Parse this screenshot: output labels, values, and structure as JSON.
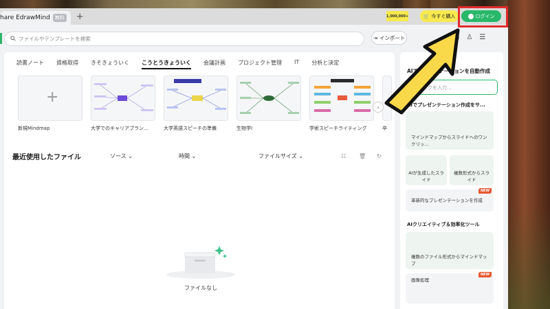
{
  "titlebar": {
    "app_title": "hare EdrawMind",
    "plan_badge": "無料",
    "new_tab_symbol": "+",
    "promo_text": "1,000,000+",
    "buy_label": "今すぐ購入",
    "login_label": "ログイン"
  },
  "toolbar": {
    "search_placeholder": "ファイルやテンプレートを検索",
    "import_label": "インポート"
  },
  "tabs": [
    "読書ノート",
    "資格取得",
    "きそきょういく",
    "こうとうきょういく",
    "会議計画",
    "プロジェクト管理",
    "IT",
    "分析と決定"
  ],
  "active_tab": "こうとうきょういく",
  "templates": [
    {
      "name": "新規Mindmap"
    },
    {
      "name": "大学でのキャリアプラン..."
    },
    {
      "name": "大学英語スピーチの準備"
    },
    {
      "name": "生物学I"
    },
    {
      "name": "学術スピーチライティング"
    },
    {
      "name": "卒"
    }
  ],
  "recent": {
    "title": "最近使用したファイル",
    "col_source": "ソース",
    "col_time": "時間",
    "col_size": "ファイルサイズ",
    "empty_label": "ファイルなし"
  },
  "sidebar": {
    "ai_title": "AIでプレゼンテーションを自動作成",
    "input_placeholder": "トピックを入力...",
    "presentation_title": "AIでプレゼンテーション作成をサ...",
    "card1": "マインドマップからスライドへのワンクリッ...",
    "card2": "AIが生成したスライド",
    "card3": "複数形式からスライド",
    "card4": "革新的なプレゼンテーションを作成",
    "tools_title": "AIクリエイティブ＆効率化ツール",
    "card5": "複数のファイル形式からマインドマップ",
    "card6": "画像処理",
    "new_tag": "NEW"
  },
  "colors": {
    "accent_green": "#28b869",
    "highlight_red": "#e02b2b",
    "buy_yellow": "#f8e94e",
    "arrow_yellow": "#f9d84a"
  }
}
